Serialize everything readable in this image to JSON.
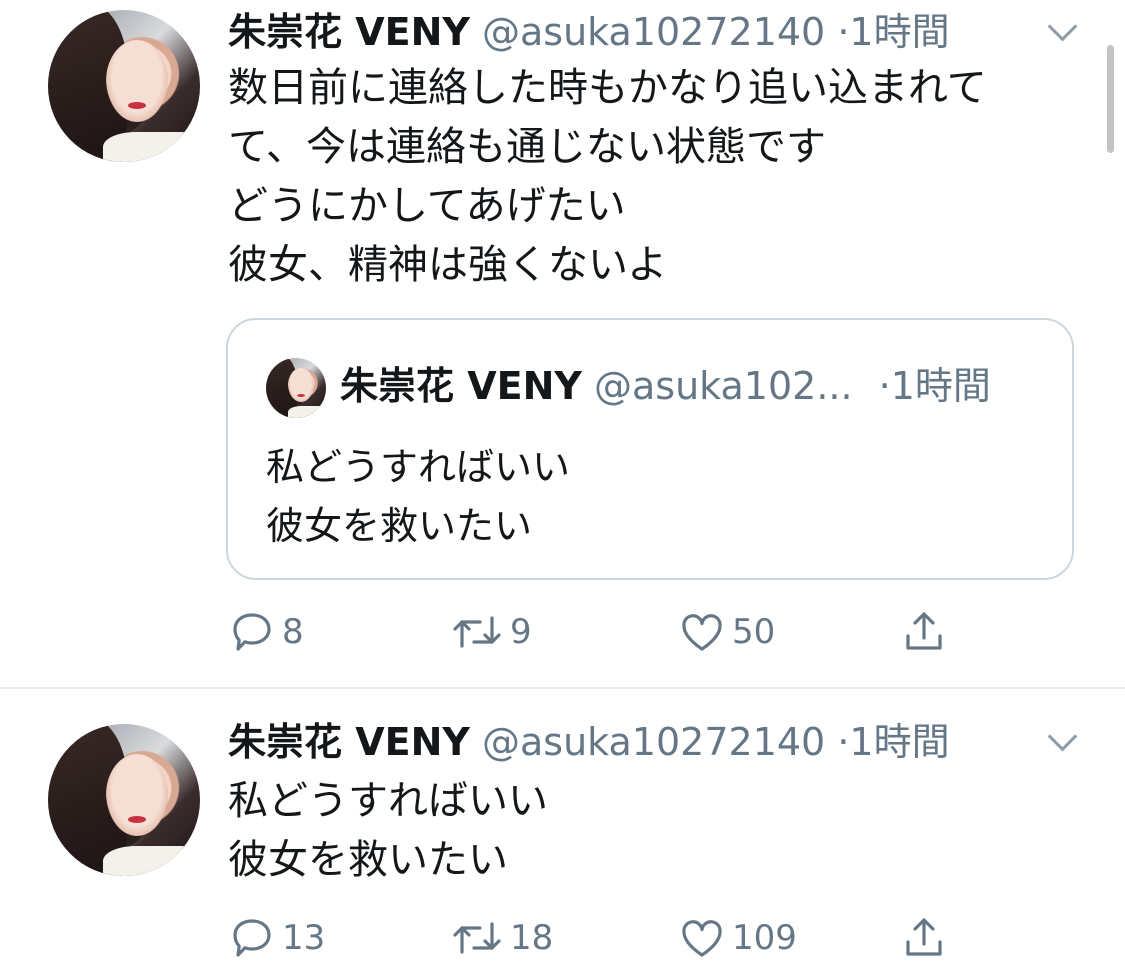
{
  "tweets": [
    {
      "name": "朱崇花 VENY",
      "handle": "@asuka10272140",
      "dot": "·",
      "time": "1時間",
      "lines": [
        "数日前に連絡した時もかなり追い込まれて",
        "て、今は連絡も通じない状態です",
        "どうにかしてあげたい",
        "彼女、精神は強くないよ"
      ],
      "quote": {
        "name": "朱崇花 VENY",
        "handle": "@asuka102...",
        "time": "·1時間",
        "lines": [
          "私どうすればいい",
          "彼女を救いたい"
        ]
      },
      "replies": "8",
      "retweets": "9",
      "likes": "50"
    },
    {
      "name": "朱崇花 VENY",
      "handle": "@asuka10272140",
      "dot": "·",
      "time": "1時間",
      "lines": [
        "私どうすればいい",
        "彼女を救いたい"
      ],
      "replies": "13",
      "retweets": "18",
      "likes": "109"
    }
  ],
  "icons": {
    "reply": "reply-icon",
    "retweet": "retweet-icon",
    "like": "heart-icon",
    "share": "share-icon",
    "caret": "chevron-down-icon"
  },
  "colors": {
    "text": "#14171a",
    "secondary": "#657786",
    "border": "#ccd6dd"
  }
}
